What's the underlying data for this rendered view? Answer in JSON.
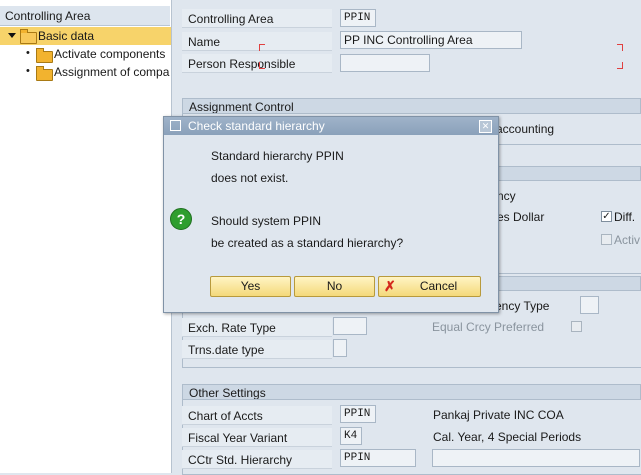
{
  "tree": {
    "header": "Controlling Area",
    "items": [
      {
        "label": "Basic data"
      },
      {
        "label": "Activate components"
      },
      {
        "label": "Assignment of compa"
      }
    ]
  },
  "header_fields": {
    "controlling_area_label": "Controlling Area",
    "controlling_area_value": "PPIN",
    "name_label": "Name",
    "name_value": "PP INC Controlling Area",
    "person_responsible_label": "Person Responsible",
    "person_responsible_value": ""
  },
  "assignment_control": {
    "title": "Assignment Control",
    "accounting_fragment": "accounting",
    "currency_fragment": "ncy",
    "dollar_fragment": "es Dollar",
    "diff_label": "Diff.",
    "activ_label": "Activ",
    "currency_type_label": "ency Type",
    "currency_type_value": "",
    "exch_rate_label": "Exch. Rate Type",
    "exch_rate_value": "",
    "equal_crcy_label": "Equal Crcy Preferred",
    "trns_date_label": "Trns.date type",
    "trns_date_value": ""
  },
  "other_settings": {
    "title": "Other Settings",
    "chart_label": "Chart of Accts",
    "chart_value": "PPIN",
    "chart_desc": "Pankaj Private INC COA",
    "fiscal_label": "Fiscal Year Variant",
    "fiscal_value": "K4",
    "fiscal_desc": "Cal. Year, 4 Special Periods",
    "cctr_label": "CCtr Std. Hierarchy",
    "cctr_value": "PPIN",
    "cctr_desc": ""
  },
  "dialog": {
    "title": "Check standard hierarchy",
    "line1": "Standard hierarchy PPIN",
    "line2": "does not exist.",
    "line3": "Should system PPIN",
    "line4": "be created as a standard hierarchy?",
    "yes": "Yes",
    "no": "No",
    "cancel": "Cancel"
  }
}
